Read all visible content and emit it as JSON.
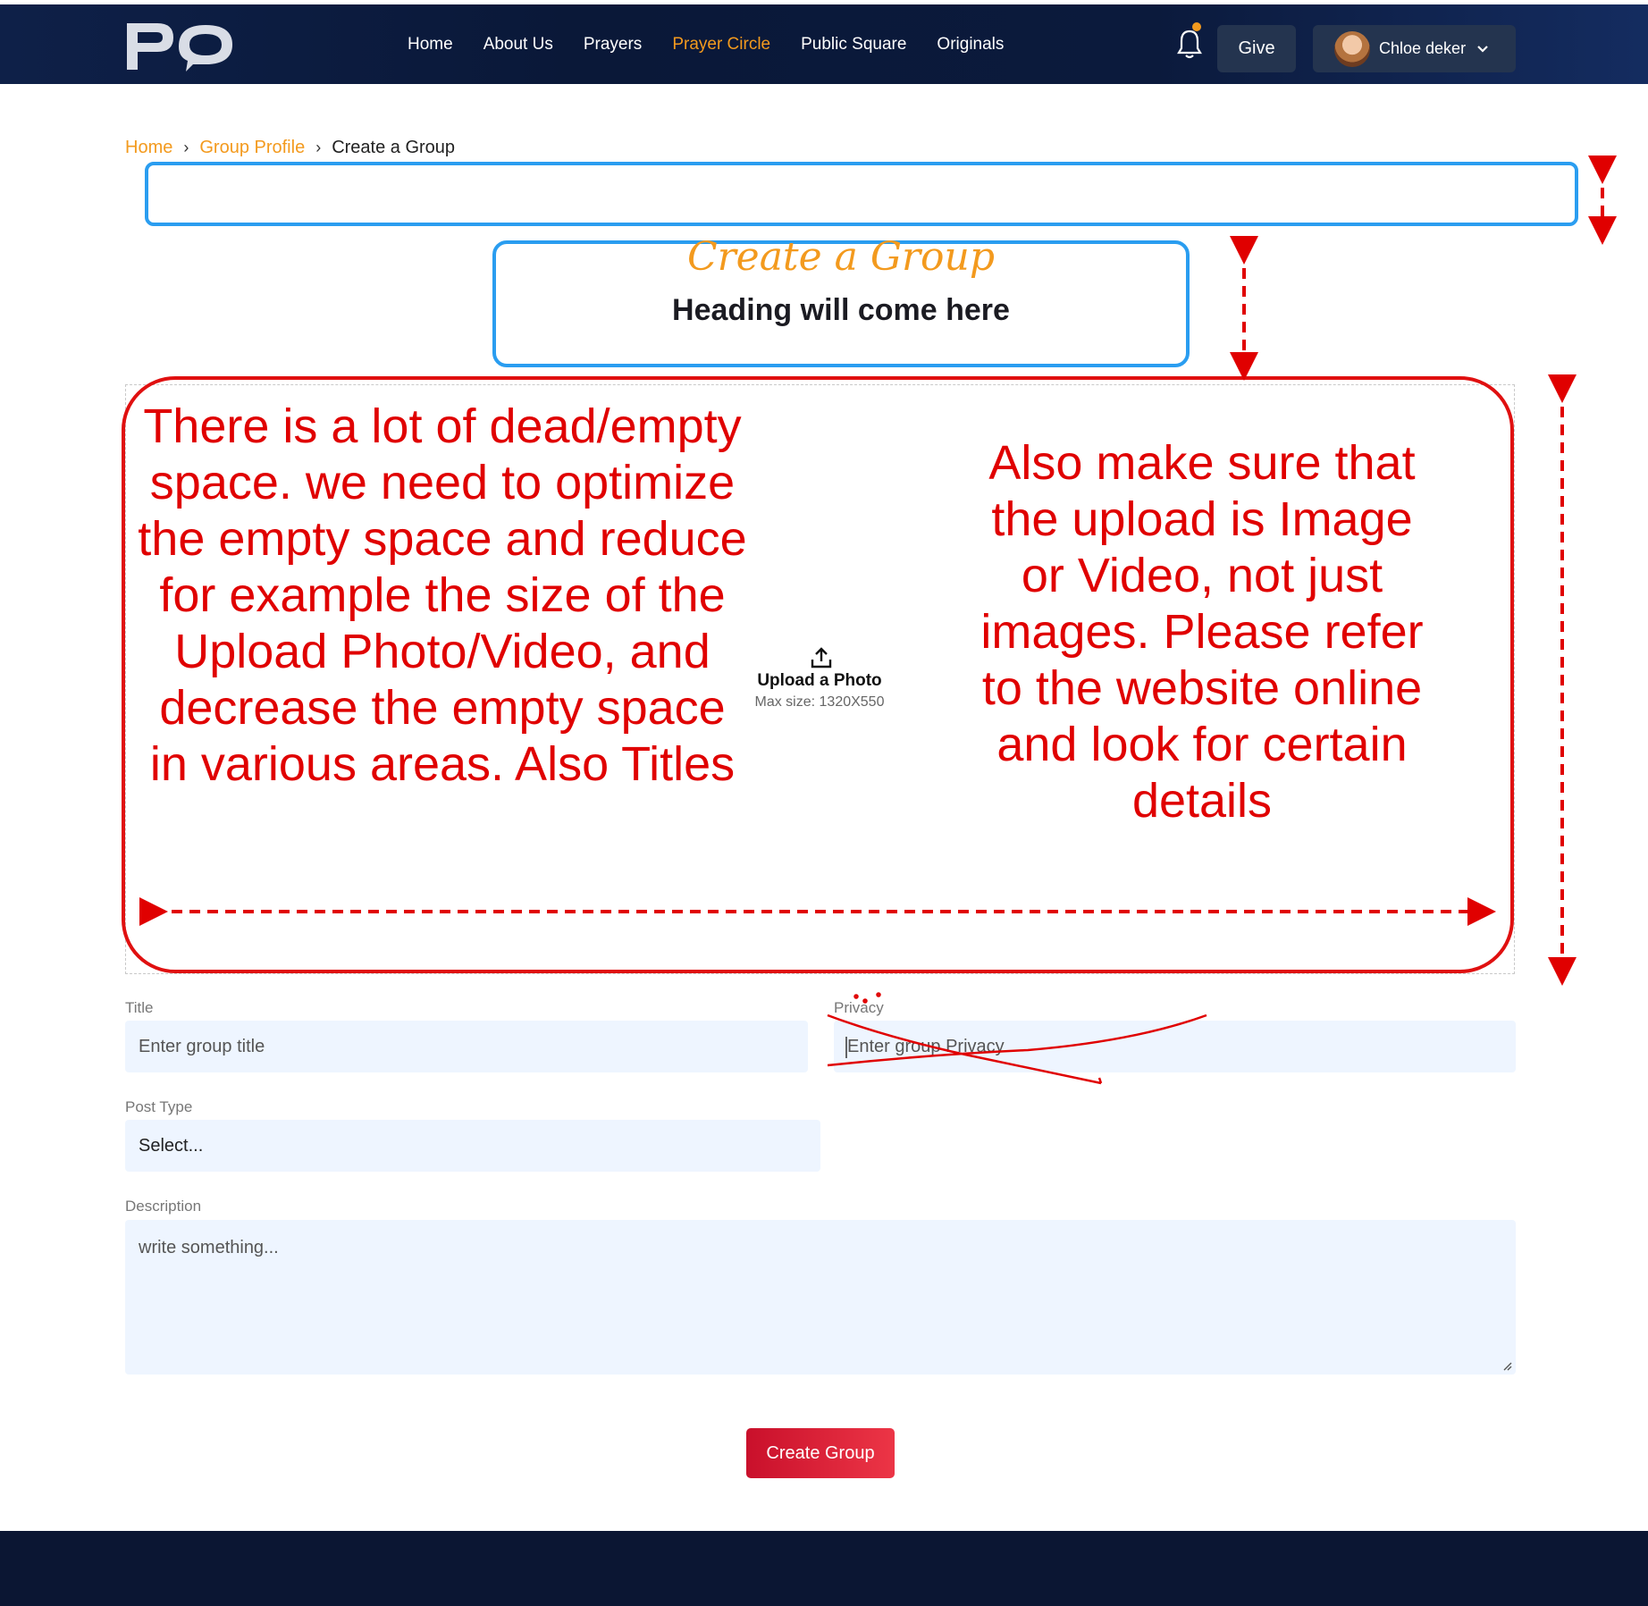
{
  "header": {
    "nav": [
      {
        "label": "Home"
      },
      {
        "label": "About Us"
      },
      {
        "label": "Prayers"
      },
      {
        "label": "Prayer Circle",
        "active": true
      },
      {
        "label": "Public Square"
      },
      {
        "label": "Originals"
      }
    ],
    "give_label": "Give",
    "user_name": "Chloe deker",
    "accent_color": "#f39a1e"
  },
  "breadcrumb": {
    "items": [
      "Home",
      "Group Profile"
    ],
    "current": "Create a Group"
  },
  "page": {
    "script_title": "Create a Group",
    "heading": "Heading will come here"
  },
  "upload": {
    "label": "Upload a Photo",
    "max_size": "Max size: 1320X550"
  },
  "annotations": {
    "left_note": "There is a lot of dead/empty space. we need to optimize the empty space and reduce for example the size of the Upload Photo/Video, and decrease the empty space in various areas. Also Titles",
    "right_note": "Also make sure that the upload is Image or Video, not just images. Please refer to the website online and look for certain  details",
    "color": "#e00000"
  },
  "form": {
    "title_label": "Title",
    "title_placeholder": "Enter group title",
    "privacy_label": "Privacy",
    "privacy_placeholder": "Enter group Privacy",
    "post_type_label": "Post Type",
    "post_type_value": "Select...",
    "description_label": "Description",
    "description_placeholder": "write something..."
  },
  "submit_label": "Create Group"
}
